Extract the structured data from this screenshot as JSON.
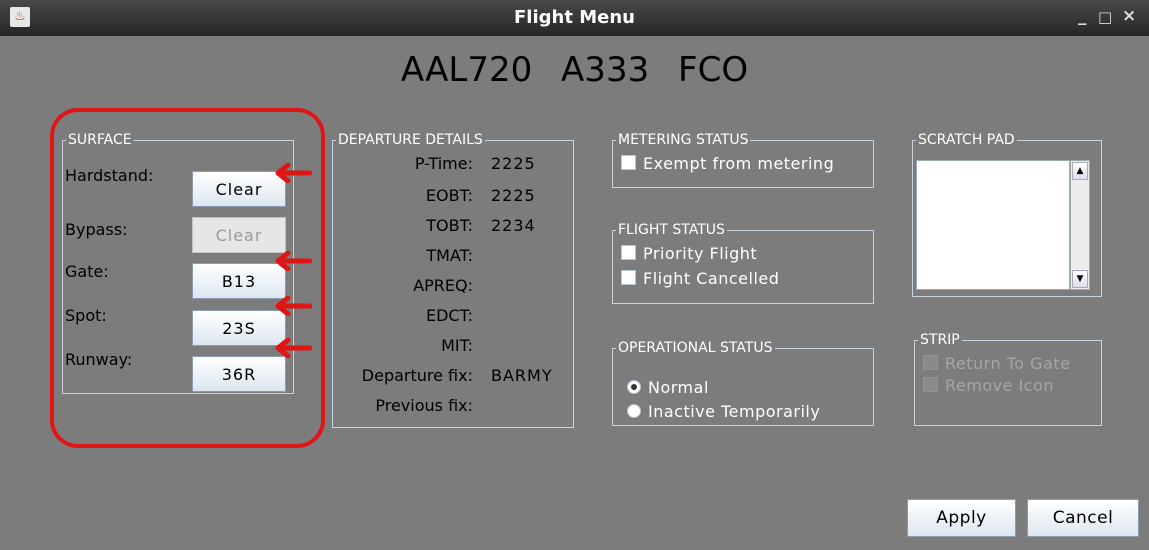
{
  "window": {
    "title": "Flight Menu",
    "controls": [
      "_",
      "□",
      "×"
    ]
  },
  "header": {
    "callsign": "AAL720",
    "aircraft": "A333",
    "destination": "FCO"
  },
  "surface": {
    "legend": "SURFACE",
    "hardstand": {
      "label": "Hardstand:",
      "button": "Clear"
    },
    "bypass": {
      "label": "Bypass:",
      "button": "Clear"
    },
    "gate": {
      "label": "Gate:",
      "button": "B13"
    },
    "spot": {
      "label": "Spot:",
      "button": "23S"
    },
    "runway": {
      "label": "Runway:",
      "button": "36R"
    }
  },
  "departure": {
    "legend": "DEPARTURE DETAILS",
    "rows": [
      {
        "label": "P-Time:",
        "value": "2225"
      },
      {
        "label": "EOBT:",
        "value": "2225"
      },
      {
        "label": "TOBT:",
        "value": "2234"
      },
      {
        "label": "TMAT:",
        "value": ""
      },
      {
        "label": "APREQ:",
        "value": ""
      },
      {
        "label": "EDCT:",
        "value": ""
      },
      {
        "label": "MIT:",
        "value": ""
      },
      {
        "label": "Departure fix:",
        "value": "BARMY"
      },
      {
        "label": "Previous fix:",
        "value": ""
      }
    ]
  },
  "metering": {
    "legend": "METERING STATUS",
    "exempt_label": "Exempt from metering",
    "exempt_checked": false
  },
  "flight_status": {
    "legend": "FLIGHT STATUS",
    "priority_label": "Priority Flight",
    "cancelled_label": "Flight Cancelled"
  },
  "operational": {
    "legend": "OPERATIONAL STATUS",
    "normal_label": "Normal",
    "inactive_label": "Inactive Temporarily",
    "selected": "Normal"
  },
  "scratch": {
    "legend": "SCRATCH PAD",
    "text": "",
    "up": "▲",
    "down": "▼"
  },
  "strip": {
    "legend": "STRIP",
    "return_label": "Return To Gate",
    "remove_label": "Remove Icon"
  },
  "actions": {
    "apply": "Apply",
    "cancel": "Cancel"
  },
  "colors": {
    "window_bg": "#7c7c7c",
    "annotation": "#e01616",
    "group_border": "#c9d3e0"
  }
}
